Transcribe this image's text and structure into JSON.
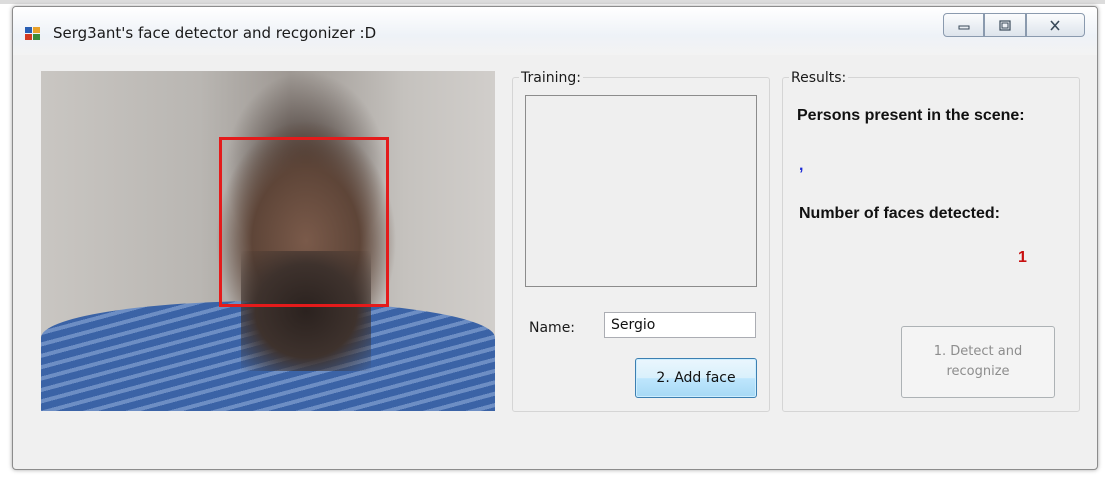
{
  "window": {
    "title": "Serg3ant's face detector and recgonizer :D"
  },
  "controls": {
    "minimize_icon": "minimize-icon",
    "maximize_icon": "maximize-icon",
    "close_icon": "close-icon"
  },
  "training": {
    "group_label": "Training:",
    "name_label": "Name:",
    "name_value": "Sergio",
    "add_button": "2. Add face"
  },
  "results": {
    "group_label": "Results:",
    "persons_label": "Persons present in the scene:",
    "persons_value": ",",
    "faces_label": "Number of faces detected:",
    "faces_value": "1",
    "detect_button": "1. Detect and recognize"
  },
  "colors": {
    "face_box": "#e41b1b",
    "persons_value": "#1c2bd6",
    "faces_value": "#c81010"
  }
}
